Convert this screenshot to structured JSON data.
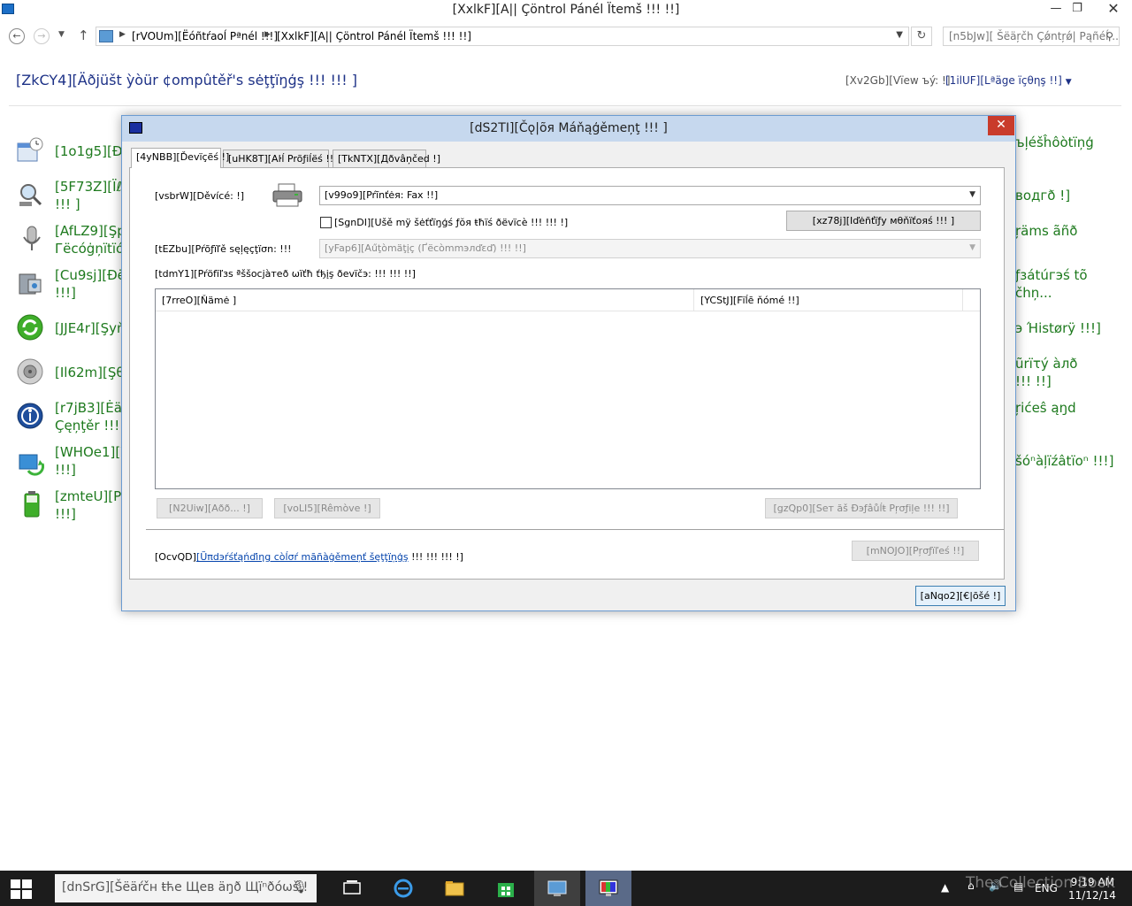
{
  "window": {
    "title": "[XxlkF][A|| Çöntrol Pánél Ïtemš !!! !!]",
    "min_label": "—",
    "max_label": "❐",
    "close_label": "✕"
  },
  "address_bar": {
    "crumb1": "[rVOUm][Ëóñtŕaoĺ Pªnél !!!]",
    "crumb2": "[XxlkF][A|| Çöntrol Pánél Ïtemš !!! !!]",
    "search_placeholder": "[n5bJw][ Šëäŗčh Çǿntŗǿ| Pąñéĺ ..."
  },
  "control_panel": {
    "heading": "[ZkCY4][Äðjüšt ỳòür ¢ompûtěř's sėţţïŋģş !!! !!! ]",
    "view_by_label": "[Xv2Gb][Vïew ъý: !]",
    "view_by_value": "[1ilUF][Lªäge ïçθηş !!]",
    "items_left": [
      "[1o1g5][Ðä",
      "[5F73Z][Ïℓo",
      "!!! ]",
      "[AfLZ9][Şp",
      "Гёсóġņïtïó",
      "[Cu9sj][Ðëv",
      "!!!]",
      "[JJE4r][Şyň",
      "[Il62m][Şθü",
      "[r7jB3][Ėäş",
      "Çęņţěr !!! !",
      "[WHOe1][W",
      "!!!]",
      "[zmteU][Pé",
      "!!!]"
    ],
    "items_right": [
      "ъļéšĥôòtïņģ",
      "вοдгð !]",
      "ŗäms ãñð",
      "ƒзátúгэś tõ",
      "čhņ...",
      "э Ήistørÿ !!!]",
      "ũrïτý àлð",
      "!!! !!]",
      "ŗićeŝ ąŋd",
      "šóⁿàļïźâtïoⁿ !!!]"
    ]
  },
  "dialog": {
    "title": "[dS2TI][Čǫ|õя Máňąģěmeņţ !!! ]",
    "close_label": "✕",
    "tabs": [
      "[4yNBB][Ďevïçẽś !]",
      "[uHK8T][Aŀĺ Prõƒiĺëś !!!]",
      "[TkNTX][Дðvâņčed !]"
    ],
    "device_label": "[vsbrW][Děvícé: !]",
    "device_value": "[v99o9][Pŕĩnťėя: Fax !!]",
    "use_settings_label": "[SgnDI][Ušě mÿ šėťťïŋģś ƒŏя ŧħïś ðëvïcè !!! !!! !]",
    "use_settings_checked": false,
    "identify_button": "[xz78j][Iďėñťïƒy мθňïťoяś !!! ]",
    "profile_selection_label": "[tEZbu][Pŕõƒïľě sęļęçţïσn: !!!",
    "profile_selection_value": "[yFap6][Aűţòmäţįç (Ґёcòmmэлďεď) !!! !!]",
    "profiles_assoc_label": "[tdmY1][Pŕöfïľзs ªššocjàтеð ωïťħ ťђįş ðevïčэ: !!! !!! !!]",
    "table": {
      "columns": [
        "[7rreO][Ňämė ]",
        "[YCStJ][Fïĺē ňómé !!]"
      ],
      "rows": []
    },
    "add_button": "[N2Uiw][Aðð... !]",
    "remove_button": "[voLI5][Rêmòve !]",
    "set_default_button": "[gzQp0][Seт ăš Ðэƒâůĺŧ Pŗσƒiļe !!! !!]",
    "understanding_prefix": "[OcvQD]",
    "understanding_link": "[Ũπdэŕśťąńďiηg còĺσŕ māñàġěmeņť šęţţïņģş",
    "understanding_suffix": " !!! !!! !!! !]",
    "profiles_button": "[mNOJO][Pŗσƒïľeś !!]",
    "close_button": "[aNqo2][€|ōšé !]"
  },
  "taskbar": {
    "search_text": "[dnSrG][Šëäŕčн ŧће Щев äŋð Щïⁿðóωš !",
    "lang": "ENG",
    "time": "9:19 AM",
    "date": "11/12/14",
    "watermark": "The Collection Book"
  }
}
